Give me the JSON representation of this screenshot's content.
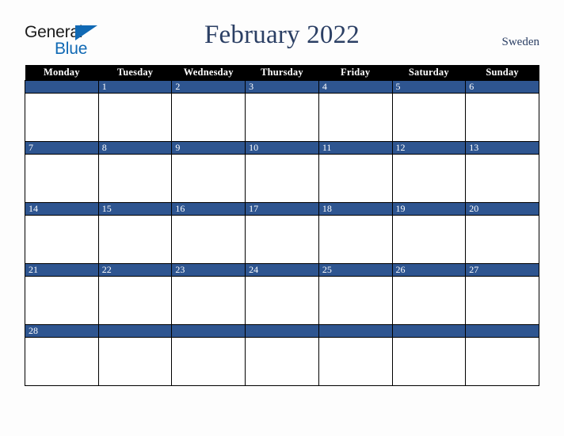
{
  "brand": {
    "name_part1": "General",
    "name_part2": "Blue",
    "triangle_color": "#1069b4",
    "text_color": "#1b1b1b"
  },
  "header": {
    "title": "February 2022",
    "country": "Sweden",
    "title_color": "#2b3f64"
  },
  "calendar": {
    "weekday_headers": [
      "Monday",
      "Tuesday",
      "Wednesday",
      "Thursday",
      "Friday",
      "Saturday",
      "Sunday"
    ],
    "header_bg": "#000000",
    "header_text": "#ffffff",
    "date_bar_color": "#2e5590",
    "date_text_color": "#ffffff",
    "cell_bg": "#ffffff",
    "weeks": [
      {
        "days": [
          "",
          "1",
          "2",
          "3",
          "4",
          "5",
          "6"
        ]
      },
      {
        "days": [
          "7",
          "8",
          "9",
          "10",
          "11",
          "12",
          "13"
        ]
      },
      {
        "days": [
          "14",
          "15",
          "16",
          "17",
          "18",
          "19",
          "20"
        ]
      },
      {
        "days": [
          "21",
          "22",
          "23",
          "24",
          "25",
          "26",
          "27"
        ]
      },
      {
        "days": [
          "28",
          "",
          "",
          "",
          "",
          "",
          ""
        ]
      }
    ]
  }
}
